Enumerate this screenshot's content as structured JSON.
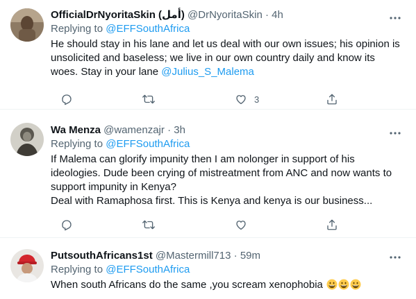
{
  "tweets": [
    {
      "display_name": "OfficialDrNyoritaSkin (أمل)",
      "handle": "@DrNyoritaSkin",
      "time": "4h",
      "replying_label": "Replying to",
      "replying_to": "@EFFSouthAfrica",
      "text_lines": [
        "He should stay in his lane and let us deal with our own issues; his opinion is",
        "unsolicited and baseless; we live in our own country daily and know its",
        "woes. Stay in your lane "
      ],
      "mention": "@Julius_S_Malema",
      "like_count": "3"
    },
    {
      "display_name": "Wa Menza",
      "handle": "@wamenzajr",
      "time": "3h",
      "replying_label": "Replying to",
      "replying_to": "@EFFSouthAfrica",
      "text_lines": [
        "If Malema can glorify impunity then I am nolonger in support of his",
        "ideologies. Dude been crying of mistreatment from ANC and now wants to",
        "support impunity in Kenya?",
        "Deal with Ramaphosa first. This is Kenya and kenya is our business..."
      ]
    },
    {
      "display_name": "PutsouthAfricans1st",
      "handle": "@Mastermill713",
      "time": "59m",
      "replying_label": "Replying to",
      "replying_to": "@EFFSouthAfrica",
      "text": "When south Africans do the same ,you scream xenophobia"
    }
  ],
  "separator": "·",
  "icons": {
    "more": "more-icon",
    "reply": "reply-icon",
    "retweet": "retweet-icon",
    "like": "like-icon",
    "share": "share-icon",
    "emoji": "grinning-face-emoji"
  }
}
